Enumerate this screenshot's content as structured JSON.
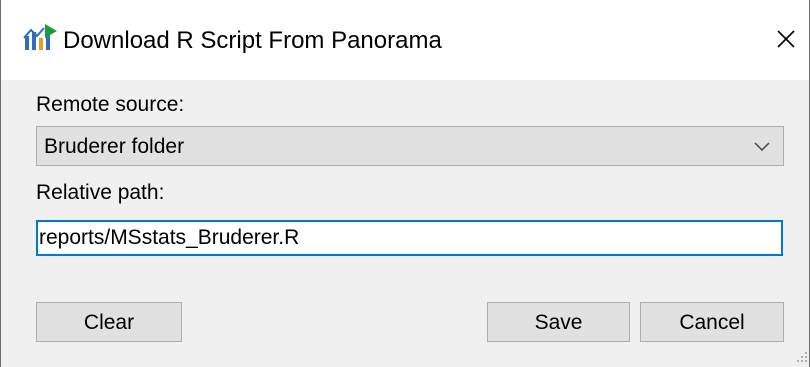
{
  "window": {
    "title": "Download R Script From Panorama",
    "app_icon": "skyline-app-icon",
    "close_icon": "close-icon"
  },
  "form": {
    "remote_source_label": "Remote source:",
    "remote_source_value": "Bruderer folder",
    "relative_path_label": "Relative path:",
    "relative_path_value": "reports/MSstats_Bruderer.R"
  },
  "buttons": {
    "clear": "Clear",
    "save": "Save",
    "cancel": "Cancel"
  },
  "colors": {
    "focus_border": "#0078d7",
    "button_bg": "#e1e1e1",
    "dialog_bg": "#f0f0f0",
    "icon_green": "#1a9e3c",
    "icon_blue": "#2e6dbf"
  }
}
